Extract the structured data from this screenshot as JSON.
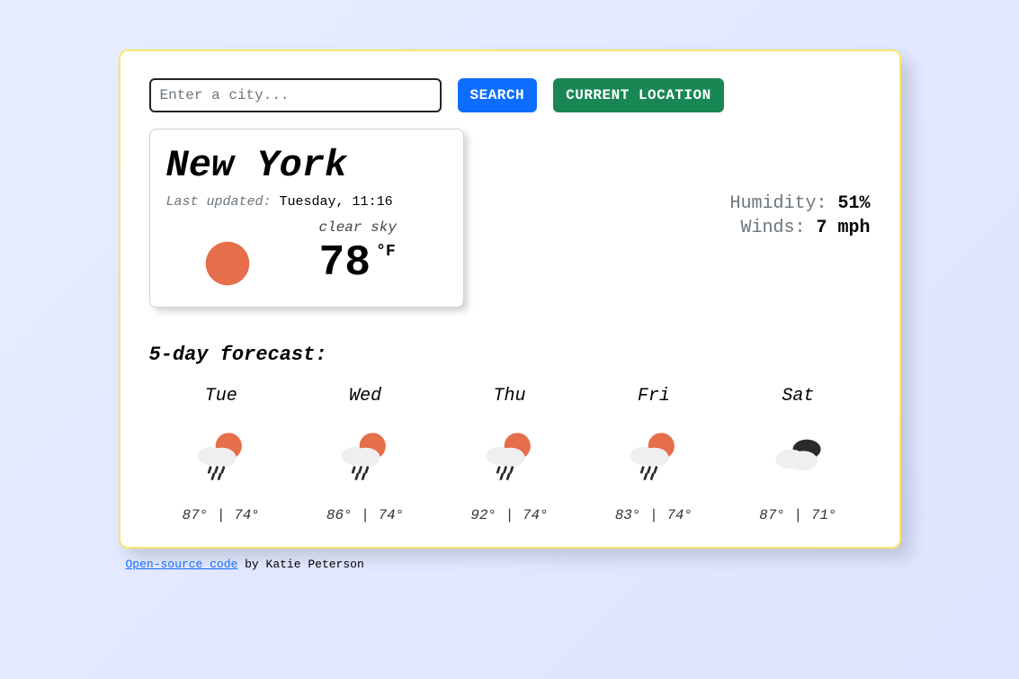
{
  "search": {
    "placeholder": "Enter a city...",
    "search_label": "SEARCH",
    "geo_label": "CURRENT LOCATION"
  },
  "overview": {
    "city": "New York",
    "updated_label": "Last updated:",
    "updated_value": "Tuesday, 11:16",
    "description": "clear sky",
    "temperature": "78",
    "unit": "°F"
  },
  "stats": {
    "humidity_label": "Humidity:",
    "humidity_value": "51%",
    "wind_label": "Winds:",
    "wind_value": "7 mph"
  },
  "forecast": {
    "title": "5-day forecast:",
    "days": [
      {
        "day": "Tue",
        "icon": "rain-sun",
        "hi": "87°",
        "lo": "74°"
      },
      {
        "day": "Wed",
        "icon": "rain-sun",
        "hi": "86°",
        "lo": "74°"
      },
      {
        "day": "Thu",
        "icon": "rain-sun",
        "hi": "92°",
        "lo": "74°"
      },
      {
        "day": "Fri",
        "icon": "rain-sun",
        "hi": "83°",
        "lo": "74°"
      },
      {
        "day": "Sat",
        "icon": "clouds",
        "hi": "87°",
        "lo": "71°"
      }
    ]
  },
  "footer": {
    "link_text": "Open-source code",
    "rest_text": " by Katie Peterson"
  }
}
